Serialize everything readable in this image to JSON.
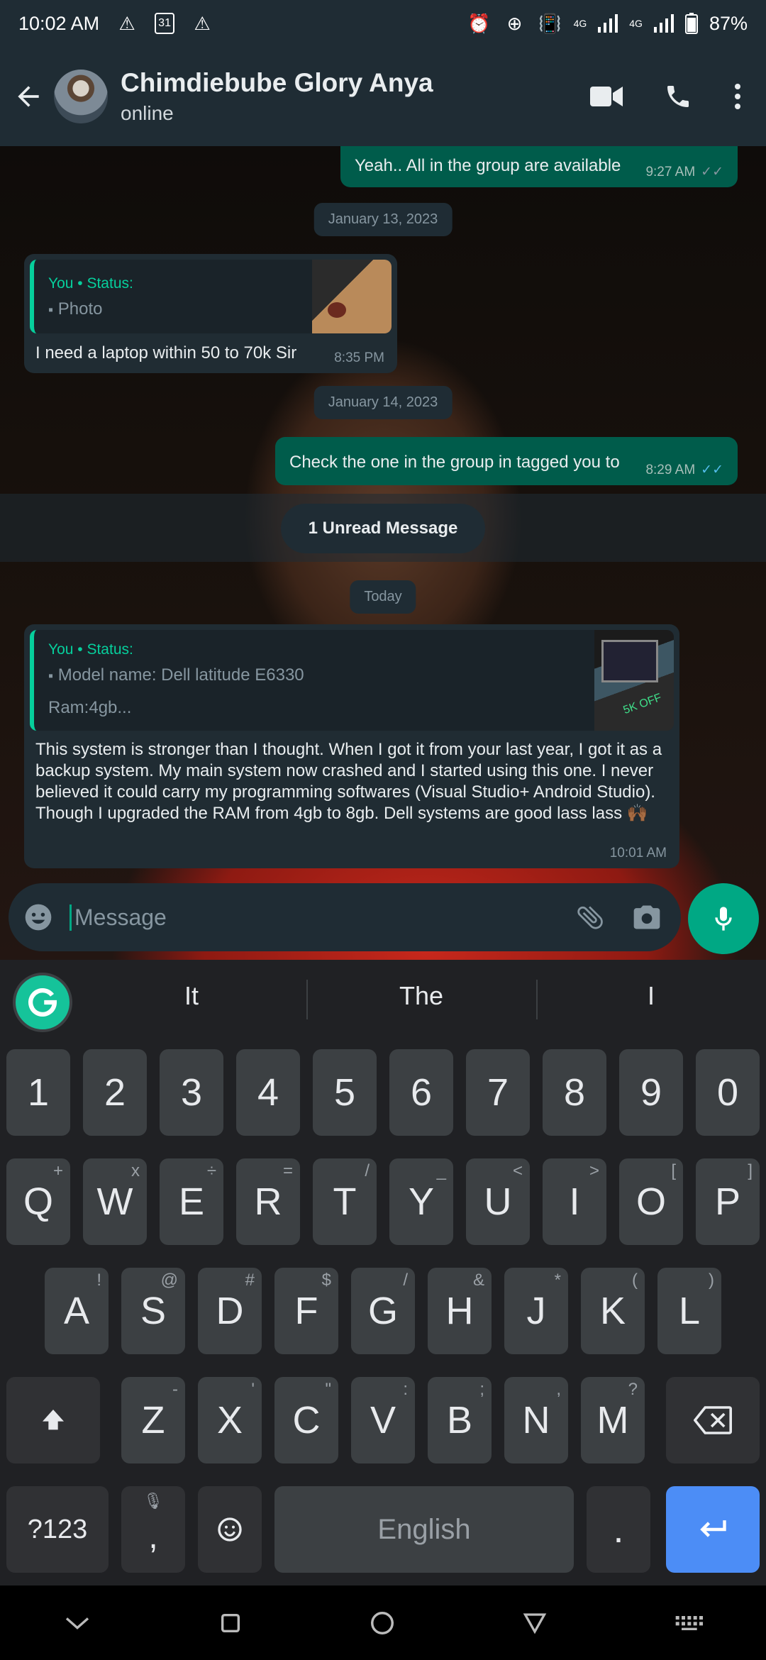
{
  "status_bar": {
    "time": "10:02 AM",
    "battery": "87%",
    "net1": "4G",
    "net2": "4G",
    "calendar": "31"
  },
  "header": {
    "name": "Chimdiebube Glory Anya",
    "status": "online"
  },
  "messages": {
    "m1": {
      "text": "Yeah.. All in the group are available",
      "time": "9:27 AM"
    },
    "d1": "January 13, 2023",
    "m2": {
      "quote_title": "You • Status:",
      "quote_text": "Photo",
      "text": "I need a laptop within 50 to 70k Sir",
      "time": "8:35 PM"
    },
    "d2": "January 14, 2023",
    "m3": {
      "text": "Check the one in the group in tagged you to",
      "time": "8:29 AM"
    },
    "unread": "1 Unread Message",
    "d3": "Today",
    "m4": {
      "quote_title": "You • Status:",
      "quote_line1": "Model name: Dell latitude E6330",
      "quote_line2": "Ram:4gb...",
      "thumb_label": "5K OFF",
      "text": "This system is stronger than I thought. When I got it from your last year, I got it as a backup system. My main system now crashed and I started using this one. I never believed it could carry my programming softwares (Visual Studio+ Android Studio). Though I upgraded the RAM from 4gb to 8gb. Dell systems are good lass lass 🙌🏾",
      "time": "10:01 AM"
    }
  },
  "composer": {
    "placeholder": "Message"
  },
  "keyboard": {
    "suggestions": [
      "It",
      "The",
      "I"
    ],
    "row_numbers": [
      "1",
      "2",
      "3",
      "4",
      "5",
      "6",
      "7",
      "8",
      "9",
      "0"
    ],
    "row_q": [
      [
        "Q",
        "+"
      ],
      [
        "W",
        "x"
      ],
      [
        "E",
        "÷"
      ],
      [
        "R",
        "="
      ],
      [
        "T",
        "/"
      ],
      [
        "Y",
        "_"
      ],
      [
        "U",
        "<"
      ],
      [
        "I",
        ">"
      ],
      [
        "O",
        "["
      ],
      [
        "P",
        "]"
      ]
    ],
    "row_a": [
      [
        "A",
        "!"
      ],
      [
        "S",
        "@"
      ],
      [
        "D",
        "#"
      ],
      [
        "F",
        "$"
      ],
      [
        "G",
        "/"
      ],
      [
        "H",
        "&"
      ],
      [
        "J",
        "*"
      ],
      [
        "K",
        "("
      ],
      [
        "L",
        ")"
      ]
    ],
    "row_z": [
      [
        "Z",
        "-"
      ],
      [
        "X",
        "'"
      ],
      [
        "C",
        "\""
      ],
      [
        "V",
        ":"
      ],
      [
        "B",
        ";"
      ],
      [
        "N",
        ","
      ],
      [
        "M",
        "?"
      ]
    ],
    "symbols": "?123",
    "comma": ",",
    "space": "English",
    "period": "."
  }
}
